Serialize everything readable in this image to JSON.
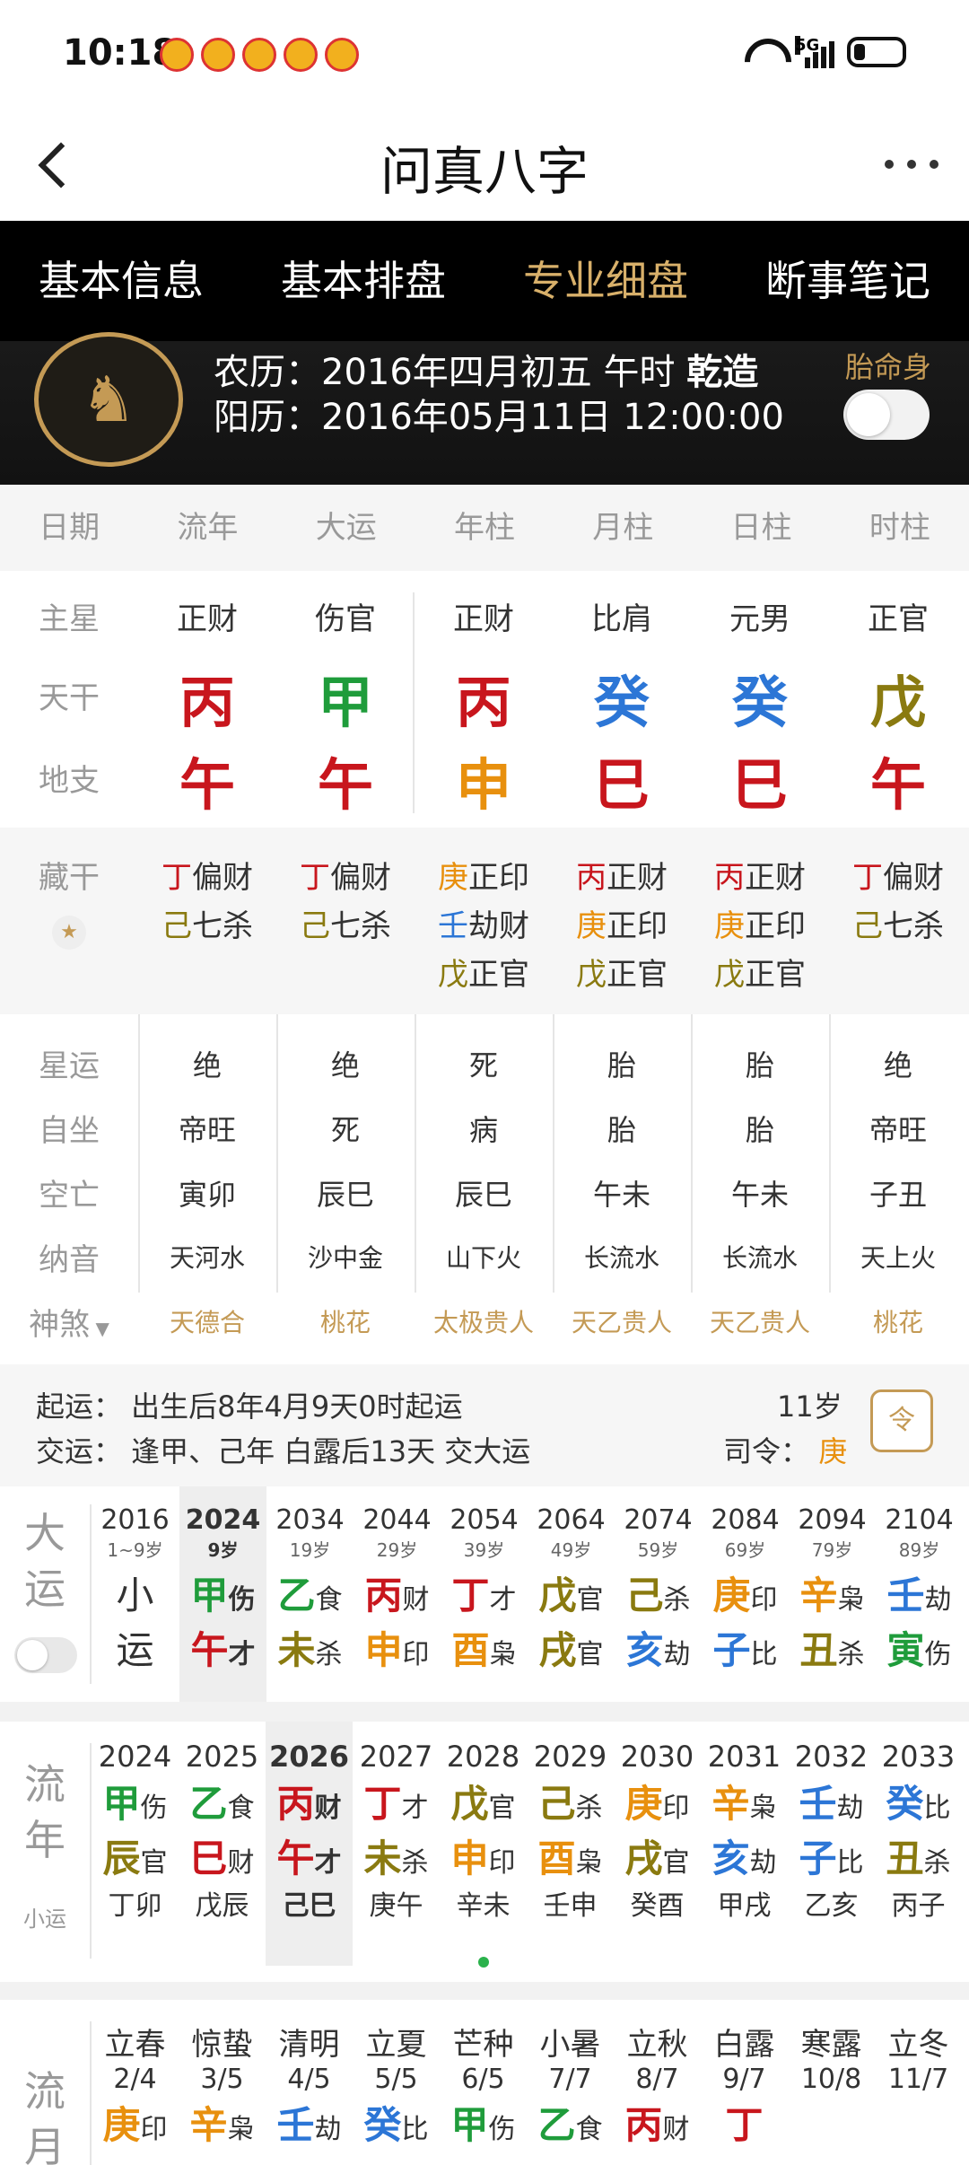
{
  "status": {
    "time": "10:18",
    "network": "5G"
  },
  "header": {
    "title": "问真八字"
  },
  "tabs": [
    {
      "label": "基本信息",
      "active": false
    },
    {
      "label": "基本排盘",
      "active": false
    },
    {
      "label": "专业细盘",
      "active": true
    },
    {
      "label": "断事笔记",
      "active": false
    }
  ],
  "profile": {
    "lunar_prefix": "农历：",
    "lunar": "2016年四月初五 午时 ",
    "gender_tag": "乾造",
    "solar_prefix": "阳历：",
    "solar": "2016年05月11日 12:00:00",
    "option_label": "胎命身",
    "option_on": false
  },
  "columns": [
    "日期",
    "流年",
    "大运",
    "年柱",
    "月柱",
    "日柱",
    "时柱"
  ],
  "main": {
    "row_labels": [
      "主星",
      "天干",
      "地支"
    ],
    "main_star": [
      "正财",
      "伤官",
      "正财",
      "比肩",
      "元男",
      "正官"
    ],
    "stems": [
      "丙",
      "甲",
      "丙",
      "癸",
      "癸",
      "戊"
    ],
    "branches": [
      "午",
      "午",
      "申",
      "巳",
      "巳",
      "午"
    ]
  },
  "hidden": {
    "label": "藏干",
    "cols": [
      [
        [
          "丁",
          "偏财"
        ],
        [
          "己",
          "七杀"
        ]
      ],
      [
        [
          "丁",
          "偏财"
        ],
        [
          "己",
          "七杀"
        ]
      ],
      [
        [
          "庚",
          "正印"
        ],
        [
          "壬",
          "劫财"
        ],
        [
          "戊",
          "正官"
        ]
      ],
      [
        [
          "丙",
          "正财"
        ],
        [
          "庚",
          "正印"
        ],
        [
          "戊",
          "正官"
        ]
      ],
      [
        [
          "丙",
          "正财"
        ],
        [
          "庚",
          "正印"
        ],
        [
          "戊",
          "正官"
        ]
      ],
      [
        [
          "丁",
          "偏财"
        ],
        [
          "己",
          "七杀"
        ]
      ]
    ]
  },
  "xing": {
    "labels": [
      "星运",
      "自坐",
      "空亡",
      "纳音",
      "神煞"
    ],
    "xingyun": [
      "绝",
      "绝",
      "死",
      "胎",
      "胎",
      "绝"
    ],
    "zizuo": [
      "帝旺",
      "死",
      "病",
      "胎",
      "胎",
      "帝旺"
    ],
    "kongwang": [
      "寅卯",
      "辰巳",
      "辰巳",
      "午未",
      "午未",
      "子丑"
    ],
    "nayin": [
      "天河水",
      "沙中金",
      "山下火",
      "长流水",
      "长流水",
      "天上火"
    ],
    "shensha": [
      "天德合",
      "桃花",
      "太极贵人",
      "天乙贵人",
      "天乙贵人",
      "桃花"
    ]
  },
  "qiyun": {
    "line1": "起运：  出生后8年4月9天0时起运",
    "line2": "交运：  逢甲、己年 白露后13天 交大运",
    "age": "11岁",
    "siling_label": "司令：",
    "siling": "庚",
    "icon": "令"
  },
  "dayun": {
    "label": [
      "大",
      "运"
    ],
    "items": [
      {
        "year": "2016",
        "age": "1~9岁",
        "g": "小",
        "gs": "",
        "z": "运",
        "zs": ""
      },
      {
        "year": "2024",
        "age": "9岁",
        "g": "甲",
        "gs": "伤",
        "z": "午",
        "zs": "才"
      },
      {
        "year": "2034",
        "age": "19岁",
        "g": "乙",
        "gs": "食",
        "z": "未",
        "zs": "杀"
      },
      {
        "year": "2044",
        "age": "29岁",
        "g": "丙",
        "gs": "财",
        "z": "申",
        "zs": "印"
      },
      {
        "year": "2054",
        "age": "39岁",
        "g": "丁",
        "gs": "才",
        "z": "酉",
        "zs": "枭"
      },
      {
        "year": "2064",
        "age": "49岁",
        "g": "戊",
        "gs": "官",
        "z": "戌",
        "zs": "官"
      },
      {
        "year": "2074",
        "age": "59岁",
        "g": "己",
        "gs": "杀",
        "z": "亥",
        "zs": "劫"
      },
      {
        "year": "2084",
        "age": "69岁",
        "g": "庚",
        "gs": "印",
        "z": "子",
        "zs": "比"
      },
      {
        "year": "2094",
        "age": "79岁",
        "g": "辛",
        "gs": "枭",
        "z": "丑",
        "zs": "杀"
      },
      {
        "year": "2104",
        "age": "89岁",
        "g": "壬",
        "gs": "劫",
        "z": "寅",
        "zs": "伤"
      }
    ]
  },
  "liunian": {
    "label": [
      "流",
      "年"
    ],
    "sub": "小运",
    "items": [
      {
        "year": "2024",
        "g": "甲",
        "gs": "伤",
        "z": "辰",
        "zs": "官",
        "x": "丁卯"
      },
      {
        "year": "2025",
        "g": "乙",
        "gs": "食",
        "z": "巳",
        "zs": "财",
        "x": "戊辰"
      },
      {
        "year": "2026",
        "g": "丙",
        "gs": "财",
        "z": "午",
        "zs": "才",
        "x": "己巳"
      },
      {
        "year": "2027",
        "g": "丁",
        "gs": "才",
        "z": "未",
        "zs": "杀",
        "x": "庚午"
      },
      {
        "year": "2028",
        "g": "戊",
        "gs": "官",
        "z": "申",
        "zs": "印",
        "x": "辛未"
      },
      {
        "year": "2029",
        "g": "己",
        "gs": "杀",
        "z": "酉",
        "zs": "枭",
        "x": "壬申"
      },
      {
        "year": "2030",
        "g": "庚",
        "gs": "印",
        "z": "戌",
        "zs": "官",
        "x": "癸酉"
      },
      {
        "year": "2031",
        "g": "辛",
        "gs": "枭",
        "z": "亥",
        "zs": "劫",
        "x": "甲戌"
      },
      {
        "year": "2032",
        "g": "壬",
        "gs": "劫",
        "z": "子",
        "zs": "比",
        "x": "乙亥"
      },
      {
        "year": "2033",
        "g": "癸",
        "gs": "比",
        "z": "丑",
        "zs": "杀",
        "x": "丙子"
      }
    ]
  },
  "liuyue": {
    "label": [
      "流",
      "月"
    ],
    "items": [
      {
        "term": "立春",
        "date": "2/4",
        "g": "庚",
        "gs": "印"
      },
      {
        "term": "惊蛰",
        "date": "3/5",
        "g": "辛",
        "gs": "枭"
      },
      {
        "term": "清明",
        "date": "4/5",
        "g": "壬",
        "gs": "劫"
      },
      {
        "term": "立夏",
        "date": "5/5",
        "g": "癸",
        "gs": "比"
      },
      {
        "term": "芒种",
        "date": "6/5",
        "g": "甲",
        "gs": "伤"
      },
      {
        "term": "小暑",
        "date": "7/7",
        "g": "乙",
        "gs": "食"
      },
      {
        "term": "立秋",
        "date": "8/7",
        "g": "丙",
        "gs": "财"
      },
      {
        "term": "白露",
        "date": "9/7",
        "g": "丁",
        "gs": ""
      },
      {
        "term": "寒露",
        "date": "10/8",
        "g": "",
        "gs": ""
      },
      {
        "term": "立冬",
        "date": "11/7",
        "g": "",
        "gs": ""
      }
    ]
  },
  "element_colors": {
    "wood": "#1f9c3b",
    "fire": "#c8161d",
    "earth": "#8a7a10",
    "metal": "#e8900e",
    "water": "#2c76d6"
  }
}
